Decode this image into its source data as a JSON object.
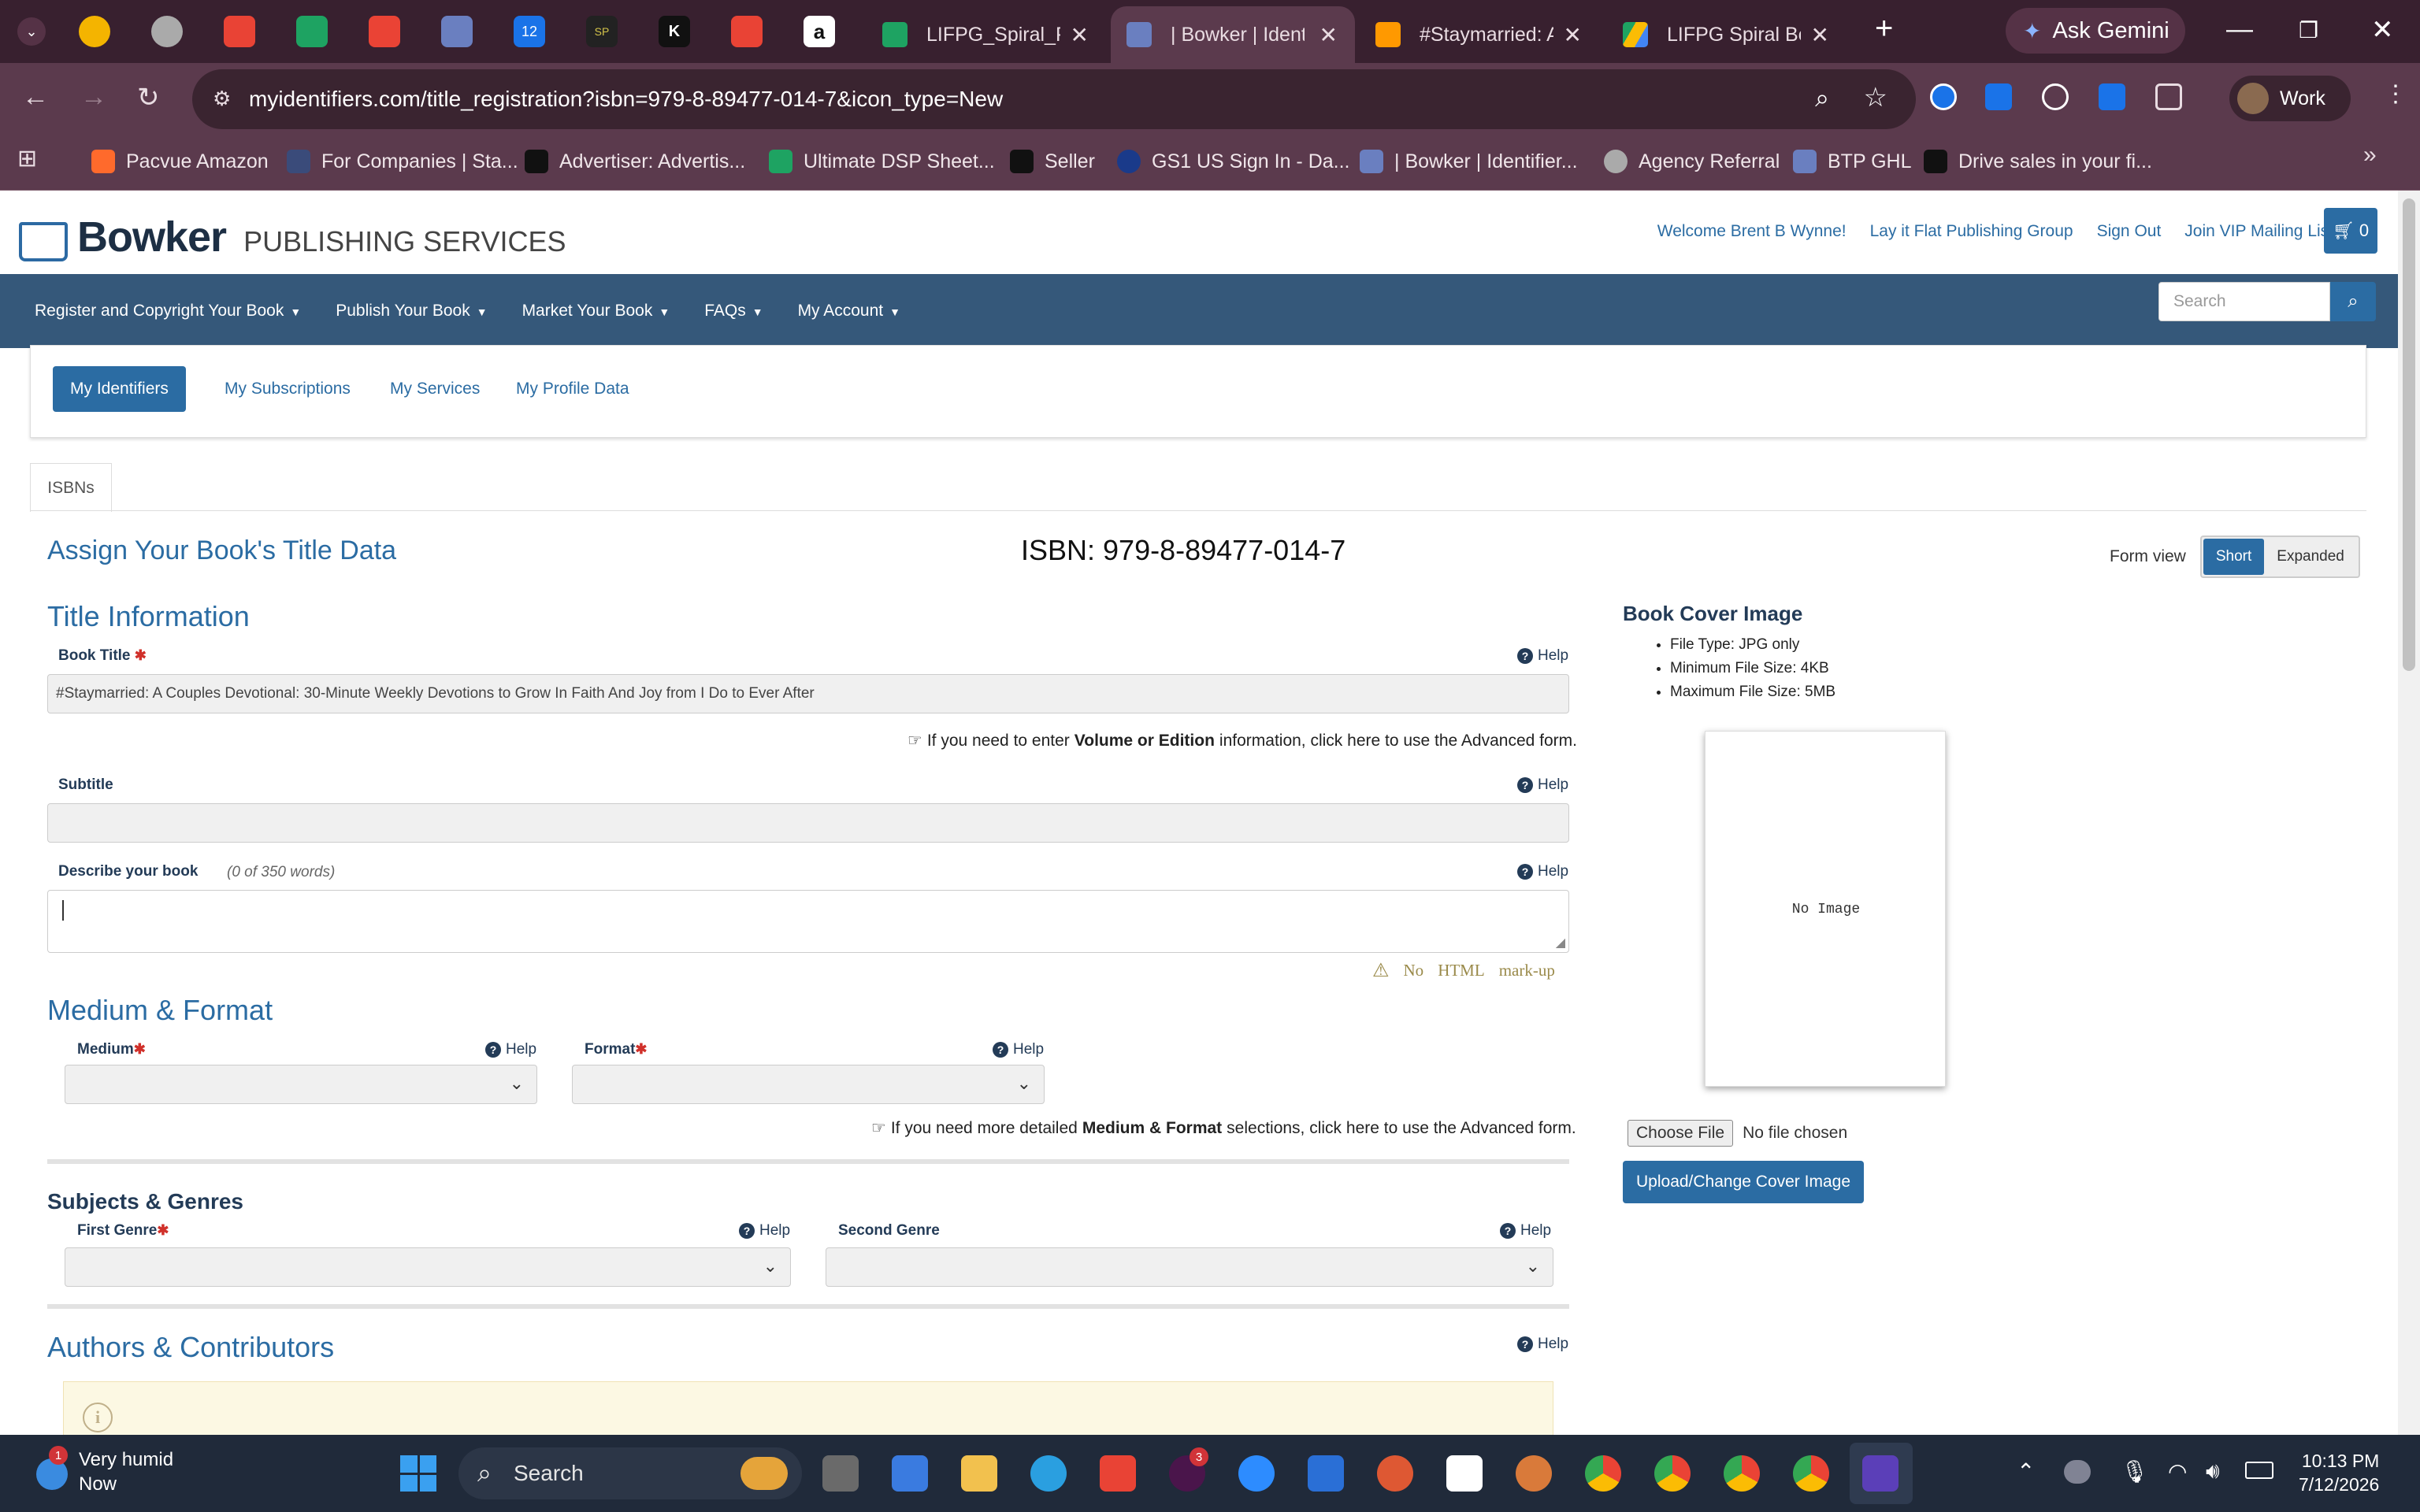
{
  "browser": {
    "tabs": [
      {
        "label": "LIFPG_Spiral_Pip"
      },
      {
        "label": "| Bowker | Identif"
      },
      {
        "label": "#Staymarried: A"
      },
      {
        "label": "LIFPG Spiral Bou"
      }
    ],
    "gemini_label": "Ask Gemini",
    "url": "myidentifiers.com/title_registration?isbn=979-8-89477-014-7&icon_type=New",
    "profile_label": "Work",
    "bookmarks": [
      "Pacvue Amazon",
      "For Companies | Sta...",
      "Advertiser: Advertis...",
      "Ultimate DSP Sheet...",
      "Seller",
      "GS1 US Sign In - Da...",
      "| Bowker | Identifier...",
      "Agency Referral",
      "BTP GHL",
      "Drive sales in your fi..."
    ],
    "pinned_tab_texts": {
      "sp": "SP",
      "k": "K",
      "cal": "12"
    }
  },
  "site": {
    "logo_main": "Bowker",
    "logo_sub": "PUBLISHING SERVICES",
    "top_links": [
      "Welcome Brent B Wynne!",
      "Lay it Flat Publishing Group",
      "Sign Out",
      "Join VIP Mailing List"
    ],
    "cart_count": "0",
    "nav": [
      "Register and Copyright Your Book",
      "Publish Your Book",
      "Market Your Book",
      "FAQs",
      "My Account"
    ],
    "search_placeholder": "Search",
    "subnav": [
      "My Identifiers",
      "My Subscriptions",
      "My Services",
      "My Profile Data"
    ],
    "tab_isbns": "ISBNs"
  },
  "form": {
    "heading": "Assign Your Book's Title Data",
    "isbn": "ISBN: 979-8-89477-014-7",
    "form_view_label": "Form view",
    "form_view_short": "Short",
    "form_view_expanded": "Expanded",
    "title_info": "Title Information",
    "book_title_label": "Book Title",
    "book_title_value": "#Staymarried: A Couples Devotional: 30-Minute Weekly Devotions to Grow In Faith And Joy from I Do to Ever After",
    "help": "Help",
    "advanced_note_pre": "If you need to enter ",
    "advanced_note_bold": "Volume or Edition",
    "advanced_note_post": " information, click here to use the Advanced form.",
    "subtitle_label": "Subtitle",
    "describe_label": "Describe your book",
    "describe_count": "(0 of 350 words)",
    "no_html": [
      "No",
      "HTML",
      "mark-up"
    ],
    "medium_format": "Medium & Format",
    "medium_label": "Medium",
    "format_label": "Format",
    "medium_note_pre": "If you need more detailed ",
    "medium_note_bold": "Medium & Format",
    "medium_note_post": " selections, click here to use the Advanced form.",
    "subjects": "Subjects & Genres",
    "first_genre_label": "First Genre",
    "second_genre_label": "Second Genre",
    "authors": "Authors & Contributors"
  },
  "cover": {
    "heading": "Book Cover Image",
    "rules": [
      "File Type: JPG only",
      "Minimum File Size: 4KB",
      "Maximum File Size: 5MB"
    ],
    "no_image": "No Image",
    "choose_btn": "Choose File",
    "no_file": "No file chosen",
    "upload_btn": "Upload/Change Cover Image"
  },
  "taskbar": {
    "weather_line1": "Very humid",
    "weather_line2": "Now",
    "weather_badge": "1",
    "search_label": "Search",
    "time": "10:13 PM",
    "date": "7/12/2026",
    "badge_count": "3"
  },
  "colors": {
    "accent": "#2b6ca3",
    "nav_bg": "#35587a",
    "chrome_bg": "#38202f"
  }
}
